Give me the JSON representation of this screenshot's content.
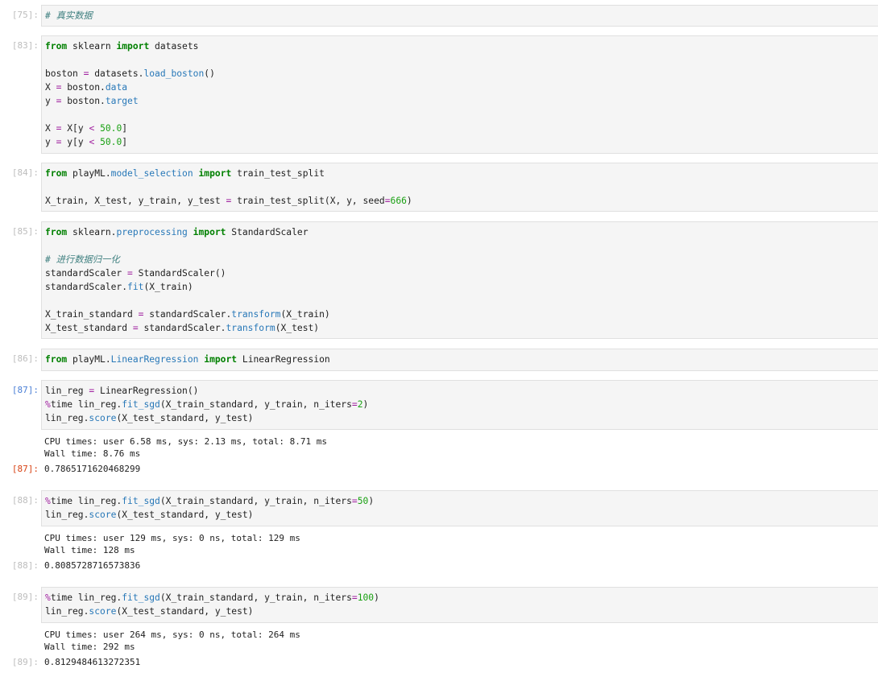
{
  "cells": [
    {
      "prompt": "[75]:",
      "lines": [
        [
          {
            "t": "# 真实数据",
            "c": "cm"
          }
        ]
      ]
    },
    {
      "prompt": "[83]:",
      "lines": [
        [
          {
            "t": "from",
            "c": "kw"
          },
          {
            "t": " sklearn "
          },
          {
            "t": "import",
            "c": "kw"
          },
          {
            "t": " datasets"
          }
        ],
        [],
        [
          {
            "t": "boston "
          },
          {
            "t": "=",
            "c": "op"
          },
          {
            "t": " datasets."
          },
          {
            "t": "load_boston",
            "c": "nb"
          },
          {
            "t": "()"
          }
        ],
        [
          {
            "t": "X "
          },
          {
            "t": "=",
            "c": "op"
          },
          {
            "t": " boston."
          },
          {
            "t": "data",
            "c": "nb"
          }
        ],
        [
          {
            "t": "y "
          },
          {
            "t": "=",
            "c": "op"
          },
          {
            "t": " boston."
          },
          {
            "t": "target",
            "c": "nb"
          }
        ],
        [],
        [
          {
            "t": "X "
          },
          {
            "t": "=",
            "c": "op"
          },
          {
            "t": " X[y "
          },
          {
            "t": "<",
            "c": "op"
          },
          {
            "t": " "
          },
          {
            "t": "50.0",
            "c": "num"
          },
          {
            "t": "]"
          }
        ],
        [
          {
            "t": "y "
          },
          {
            "t": "=",
            "c": "op"
          },
          {
            "t": " y[y "
          },
          {
            "t": "<",
            "c": "op"
          },
          {
            "t": " "
          },
          {
            "t": "50.0",
            "c": "num"
          },
          {
            "t": "]"
          }
        ]
      ]
    },
    {
      "prompt": "[84]:",
      "lines": [
        [
          {
            "t": "from",
            "c": "kw"
          },
          {
            "t": " playML."
          },
          {
            "t": "model_selection",
            "c": "nb"
          },
          {
            "t": " "
          },
          {
            "t": "import",
            "c": "kw"
          },
          {
            "t": " train_test_split"
          }
        ],
        [],
        [
          {
            "t": "X_train, X_test, y_train, y_test "
          },
          {
            "t": "=",
            "c": "op"
          },
          {
            "t": " train_test_split(X, y, seed"
          },
          {
            "t": "=",
            "c": "op"
          },
          {
            "t": "666",
            "c": "num"
          },
          {
            "t": ")"
          }
        ]
      ]
    },
    {
      "prompt": "[85]:",
      "lines": [
        [
          {
            "t": "from",
            "c": "kw"
          },
          {
            "t": " sklearn."
          },
          {
            "t": "preprocessing",
            "c": "nb"
          },
          {
            "t": " "
          },
          {
            "t": "import",
            "c": "kw"
          },
          {
            "t": " StandardScaler"
          }
        ],
        [],
        [
          {
            "t": "# 进行数据归一化",
            "c": "cm"
          }
        ],
        [
          {
            "t": "standardScaler "
          },
          {
            "t": "=",
            "c": "op"
          },
          {
            "t": " StandardScaler()"
          }
        ],
        [
          {
            "t": "standardScaler."
          },
          {
            "t": "fit",
            "c": "nb"
          },
          {
            "t": "(X_train)"
          }
        ],
        [],
        [
          {
            "t": "X_train_standard "
          },
          {
            "t": "=",
            "c": "op"
          },
          {
            "t": " standardScaler."
          },
          {
            "t": "transform",
            "c": "nb"
          },
          {
            "t": "(X_train)"
          }
        ],
        [
          {
            "t": "X_test_standard "
          },
          {
            "t": "=",
            "c": "op"
          },
          {
            "t": " standardScaler."
          },
          {
            "t": "transform",
            "c": "nb"
          },
          {
            "t": "(X_test)"
          }
        ]
      ]
    },
    {
      "prompt": "[86]:",
      "lines": [
        [
          {
            "t": "from",
            "c": "kw"
          },
          {
            "t": " playML."
          },
          {
            "t": "LinearRegression",
            "c": "nb"
          },
          {
            "t": " "
          },
          {
            "t": "import",
            "c": "kw"
          },
          {
            "t": " LinearRegression"
          }
        ]
      ]
    },
    {
      "prompt": "[87]:",
      "active": true,
      "lines": [
        [
          {
            "t": "lin_reg "
          },
          {
            "t": "=",
            "c": "op"
          },
          {
            "t": " LinearRegression()"
          }
        ],
        [
          {
            "t": "%",
            "c": "mg"
          },
          {
            "t": "time lin_reg."
          },
          {
            "t": "fit_sgd",
            "c": "nb"
          },
          {
            "t": "(X_train_standard, y_train, n_iters"
          },
          {
            "t": "=",
            "c": "op"
          },
          {
            "t": "2",
            "c": "num"
          },
          {
            "t": ")"
          }
        ],
        [
          {
            "t": "lin_reg."
          },
          {
            "t": "score",
            "c": "nb"
          },
          {
            "t": "(X_test_standard, y_test)"
          }
        ]
      ],
      "stdout": [
        "CPU times: user 6.58 ms, sys: 2.13 ms, total: 8.71 ms",
        "Wall time: 8.76 ms"
      ],
      "out_prompt": "[87]:",
      "result": "0.7865171620468299"
    },
    {
      "prompt": "[88]:",
      "lines": [
        [
          {
            "t": "%",
            "c": "mg"
          },
          {
            "t": "time lin_reg."
          },
          {
            "t": "fit_sgd",
            "c": "nb"
          },
          {
            "t": "(X_train_standard, y_train, n_iters"
          },
          {
            "t": "=",
            "c": "op"
          },
          {
            "t": "50",
            "c": "num"
          },
          {
            "t": ")"
          }
        ],
        [
          {
            "t": "lin_reg."
          },
          {
            "t": "score",
            "c": "nb"
          },
          {
            "t": "(X_test_standard, y_test)"
          }
        ]
      ],
      "stdout": [
        "CPU times: user 129 ms, sys: 0 ns, total: 129 ms",
        "Wall time: 128 ms"
      ],
      "out_prompt": "[88]:",
      "result": "0.8085728716573836"
    },
    {
      "prompt": "[89]:",
      "lines": [
        [
          {
            "t": "%",
            "c": "mg"
          },
          {
            "t": "time lin_reg."
          },
          {
            "t": "fit_sgd",
            "c": "nb"
          },
          {
            "t": "(X_train_standard, y_train, n_iters"
          },
          {
            "t": "=",
            "c": "op"
          },
          {
            "t": "100",
            "c": "num"
          },
          {
            "t": ")"
          }
        ],
        [
          {
            "t": "lin_reg."
          },
          {
            "t": "score",
            "c": "nb"
          },
          {
            "t": "(X_test_standard, y_test)"
          }
        ]
      ],
      "stdout": [
        "CPU times: user 264 ms, sys: 0 ns, total: 264 ms",
        "Wall time: 292 ms"
      ],
      "out_prompt": "[89]:",
      "result": "0.8129484613272351"
    }
  ]
}
